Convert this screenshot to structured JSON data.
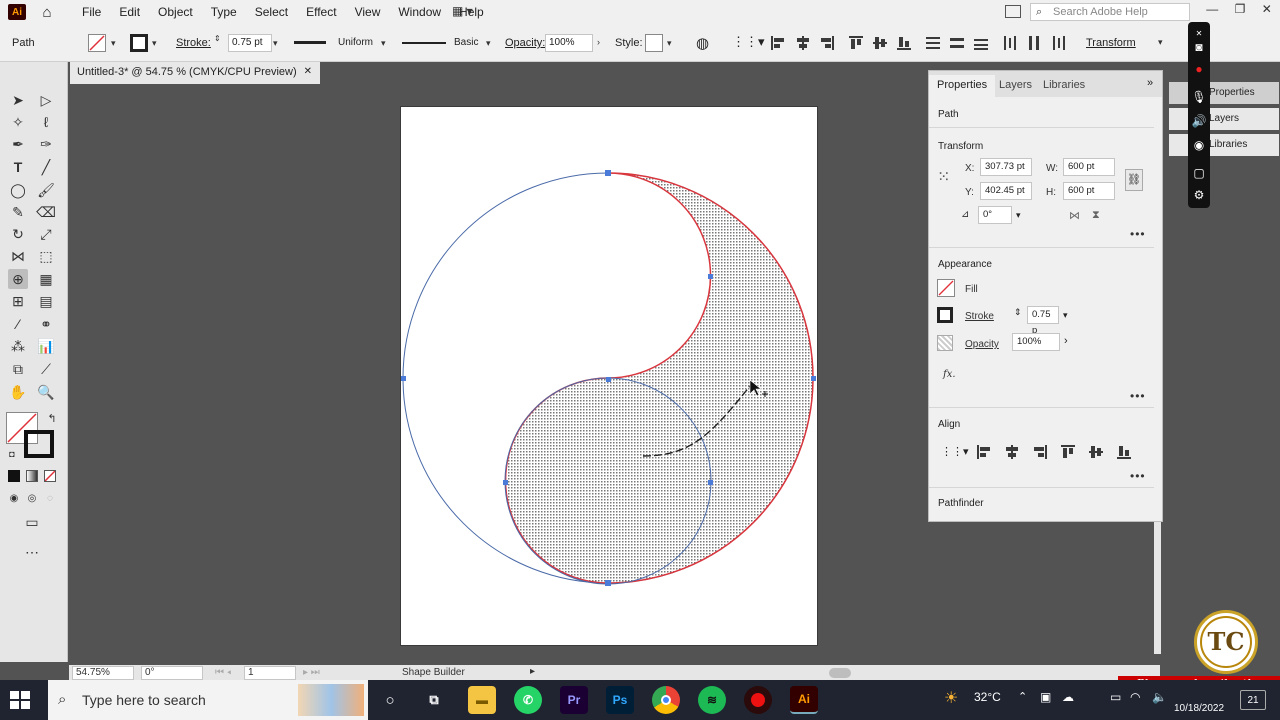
{
  "menu": {
    "app_logo": "Ai",
    "items": [
      "File",
      "Edit",
      "Object",
      "Type",
      "Select",
      "Effect",
      "View",
      "Window",
      "Help"
    ],
    "search_placeholder": "Search Adobe Help"
  },
  "control_bar": {
    "selection_label": "Path",
    "stroke_label": "Stroke:",
    "stroke_value": "0.75 pt",
    "uniform_label": "Uniform",
    "basic_label": "Basic",
    "opacity_label": "Opacity:",
    "opacity_value": "100%",
    "style_label": "Style:",
    "transform_label": "Transform"
  },
  "document_tab": {
    "title": "Untitled-3* @ 54.75 % (CMYK/CPU Preview)",
    "close": "✕"
  },
  "status_bar": {
    "zoom": "54.75%",
    "rotation": "0°",
    "artboard_num": "1",
    "tool_name": "Shape Builder"
  },
  "properties_panel": {
    "tabs": [
      "Properties",
      "Layers",
      "Libraries"
    ],
    "active_tab": "Properties",
    "object_type": "Path",
    "transform": {
      "title": "Transform",
      "x_label": "X:",
      "x_value": "307.73 pt",
      "y_label": "Y:",
      "y_value": "402.45 pt",
      "w_label": "W:",
      "w_value": "600 pt",
      "h_label": "H:",
      "h_value": "600 pt",
      "angle_value": "0°"
    },
    "appearance": {
      "title": "Appearance",
      "fill_label": "Fill",
      "stroke_label": "Stroke",
      "stroke_value": "0.75 p",
      "opacity_label": "Opacity",
      "opacity_value": "100%",
      "fx_label": "fx."
    },
    "align_title": "Align",
    "pathfinder_title": "Pathfinder"
  },
  "collapsed_panels": [
    "Properties",
    "Layers",
    "Libraries"
  ],
  "taskbar": {
    "search_placeholder": "Type here to search",
    "weather": "32°C",
    "date": "10/18/2022",
    "notification_count": "21",
    "apps": [
      "File Explorer",
      "WhatsApp",
      "Premiere Pro",
      "Photoshop",
      "Chrome",
      "Spotify",
      "Recorder",
      "Illustrator"
    ]
  },
  "watermark": {
    "subscribe_text": "Please subscribe the channel"
  },
  "colors": {
    "path_stroke": "#d9363e",
    "guide_stroke": "#4a6aa8",
    "anchor": "#4a7bd8",
    "app_accent": "#ff9a00"
  }
}
